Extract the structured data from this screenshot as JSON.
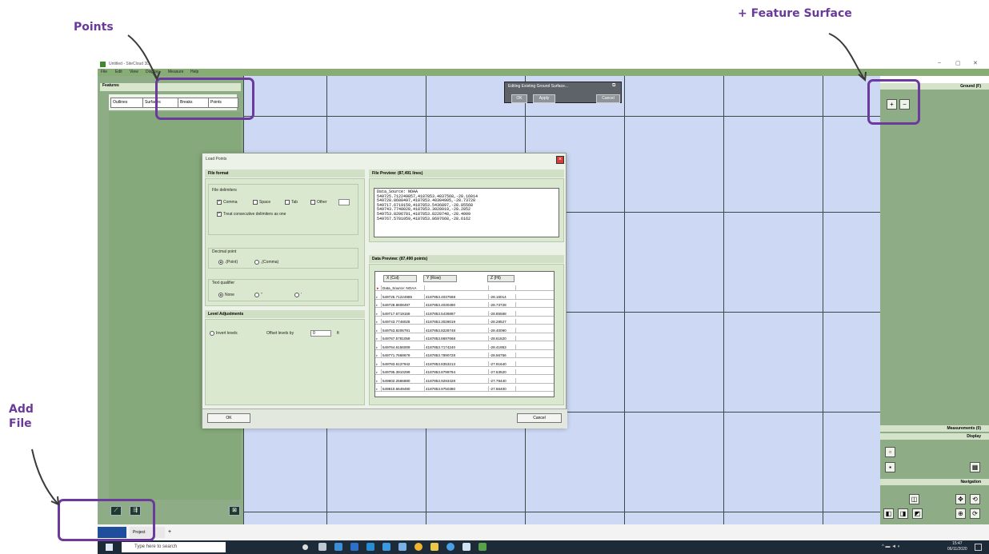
{
  "annotations": {
    "points": "Points",
    "feature_surface": "+ Feature Surface",
    "add_file_line1": "Add",
    "add_file_line2": "File"
  },
  "window": {
    "title": "Untitled - SiteCloud 3D",
    "controls": [
      "–",
      "▢",
      "✕"
    ]
  },
  "menubar": [
    "File",
    "Edit",
    "View",
    "Display",
    "Measure",
    "Help"
  ],
  "features_panel": {
    "header": "Features",
    "tabs": [
      "Outlines",
      "Surfaces",
      "Breaks",
      "Points"
    ]
  },
  "floating_toolbar": {
    "title": "Editing Existing Ground Surface...",
    "buttons": [
      "OK",
      "Apply",
      "Cancel"
    ]
  },
  "dialog": {
    "title": "Load Points",
    "file_format": {
      "header": "File format",
      "delimiters_label": "File delimiters",
      "delimiters": [
        {
          "label": "Comma",
          "checked": true
        },
        {
          "label": "Space",
          "checked": false
        },
        {
          "label": "Tab",
          "checked": false
        },
        {
          "label": "Other",
          "checked": false
        }
      ],
      "treat_consecutive": "Treat consecutive delimiters as one",
      "decimal_label": "Decimal point",
      "decimal_options": [
        {
          "label": ".(Point)",
          "selected": true
        },
        {
          "label": ",(Comma)",
          "selected": false
        }
      ],
      "text_label": "Text qualifier",
      "text_options": [
        {
          "label": "None",
          "selected": true
        },
        {
          "label": "\"",
          "selected": false
        },
        {
          "label": "'",
          "selected": false
        }
      ]
    },
    "level_adjustments": {
      "header": "Level Adjustments",
      "invert_label": "Invert levels",
      "offset_label": "Offset levels by",
      "offset_value": "0",
      "offset_unit": "ft"
    },
    "file_preview": {
      "header": "File Preview: (87,491 lines)",
      "lines": [
        "Data_Source: NOAA",
        "549725.712249857,4187853.4037568,-28.16014",
        "549728.8608497,4187853.40304905,-28.73728",
        "549717.6719159,4187853.5436897,-28.85568",
        "549743.7748028,4187853.3028019,-28.2852",
        "549753.8206781,4187853.8228748,-28.4009",
        "549767.5781059,4187853.8697668,-28.6162"
      ]
    },
    "data_preview": {
      "header": "Data Preview: (87,490 points)",
      "columns": [
        "X (Col)",
        "Y (Row)",
        "Z (Ht)"
      ],
      "rows": [
        [
          "Data_Source: NOAA",
          "",
          ""
        ],
        [
          "549725.71224985",
          "4187853.4037568",
          "-28.16014"
        ],
        [
          "549728.8608497",
          "4187853.4030490",
          "-28.73728"
        ],
        [
          "549717.6719159",
          "4187853.5436897",
          "-28.85568"
        ],
        [
          "549743.7748028",
          "4187853.3028019",
          "-28.28527"
        ],
        [
          "549753.8206781",
          "4187853.8228748",
          "-28.40090"
        ],
        [
          "549767.5781059",
          "4187853.8697668",
          "-28.61620"
        ],
        [
          "549764.6156009",
          "4187853.7174240",
          "-28.41953"
        ],
        [
          "549771.7668679",
          "4187853.7890728",
          "-28.56756"
        ],
        [
          "549783.6137942",
          "4187853.8353213",
          "-27.91640"
        ],
        [
          "549795.3910299",
          "4187853.8799794",
          "-27.53520"
        ],
        [
          "549802.2566880",
          "4187853.9293428",
          "-27.79440"
        ],
        [
          "549810.6649490",
          "4187853.9750380",
          "-27.66400"
        ]
      ]
    },
    "ok": "OK",
    "cancel": "Cancel"
  },
  "right_panel": {
    "ground_header": "Ground (F)",
    "measurements_header": "Measurements (0)",
    "display_header": "Display",
    "navigation_header": "Navigation",
    "add_button": "+",
    "remove_button": "−"
  },
  "bottom_tabs": [
    "",
    "Project",
    "+"
  ],
  "taskbar": {
    "search_placeholder": "Type here to search",
    "time": "15:47",
    "date": "06/11/2020"
  }
}
